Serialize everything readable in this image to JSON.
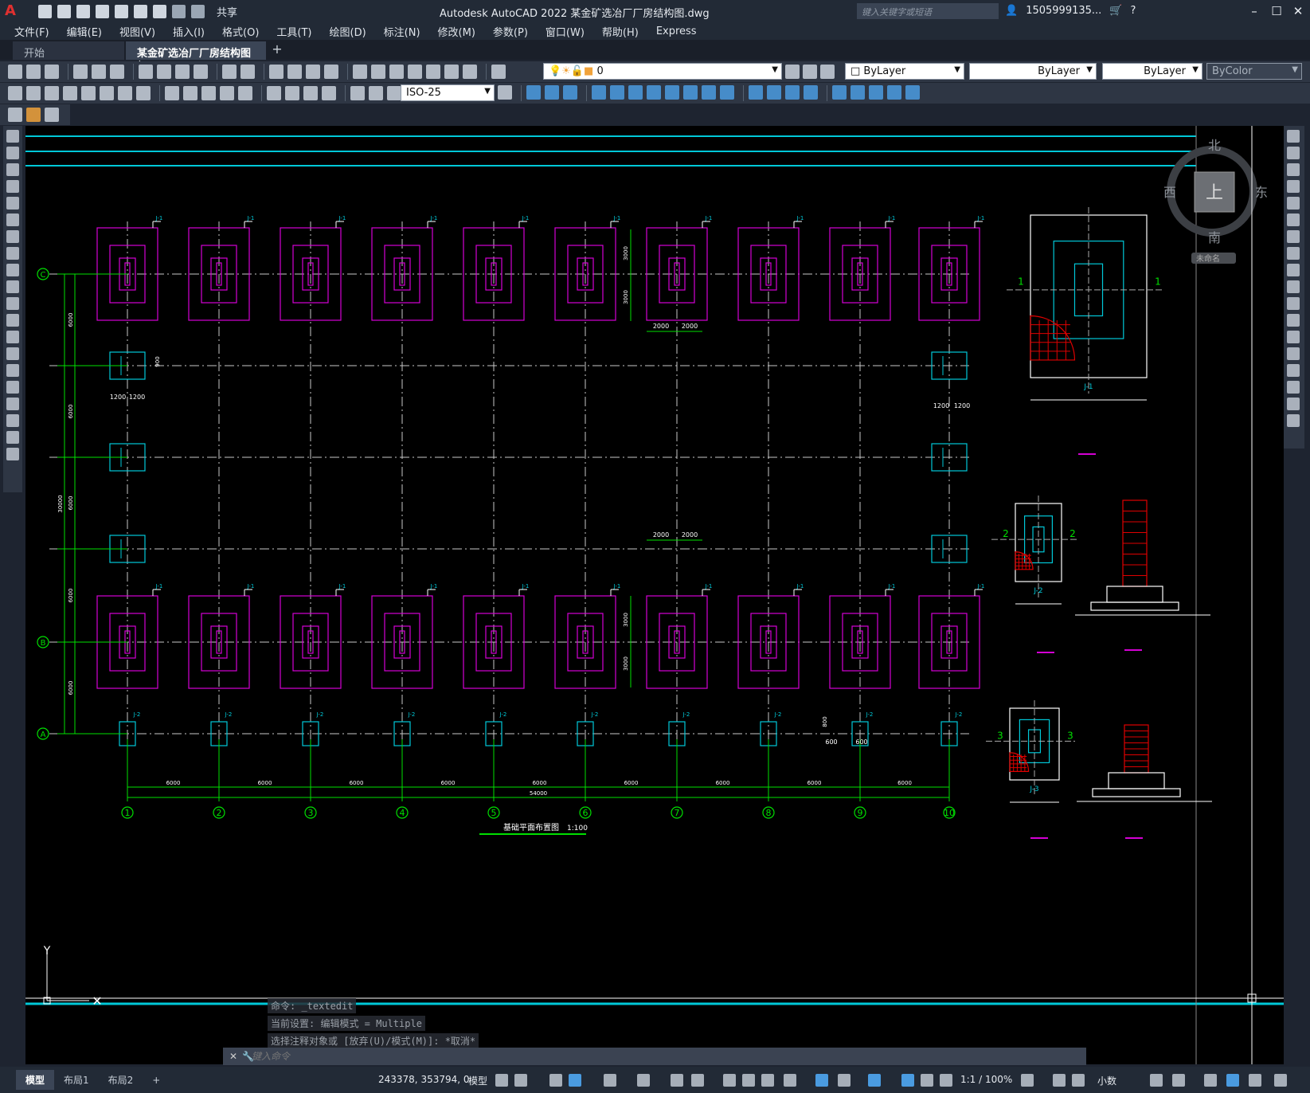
{
  "window": {
    "title": "Autodesk AutoCAD 2022    某金矿选冶厂厂房结构图.dwg",
    "share": "共享",
    "search_placeholder": "键入关键字或短语",
    "user": "1505999135..."
  },
  "menu": [
    "文件(F)",
    "编辑(E)",
    "视图(V)",
    "插入(I)",
    "格式(O)",
    "工具(T)",
    "绘图(D)",
    "标注(N)",
    "修改(M)",
    "参数(P)",
    "窗口(W)",
    "帮助(H)",
    "Express"
  ],
  "tabs": [
    {
      "label": "开始"
    },
    {
      "label": "某金矿选冶厂厂房结构图*"
    }
  ],
  "toolbar": {
    "layer": "0",
    "color": "ByLayer",
    "linetype": "ByLayer",
    "lineweight": "ByLayer",
    "plotstyle": "ByColor",
    "dimstyle": "ISO-25"
  },
  "viewcube": {
    "north": "北",
    "south": "南",
    "east": "东",
    "west": "西",
    "top": "上",
    "ucs": "未命名"
  },
  "drawing": {
    "plan_title": "基础平面布置图",
    "plan_scale": "1:100",
    "grid_cols": [
      "1",
      "2",
      "3",
      "4",
      "5",
      "6",
      "7",
      "8",
      "9",
      "10"
    ],
    "grid_rows": [
      "C",
      "B",
      "A"
    ],
    "bay_dim": "6000",
    "total_dim": "54000",
    "side_dims": [
      "6000",
      "6000",
      "6000",
      "6000",
      "6000"
    ],
    "side_total": "30000",
    "footing_dims": {
      "w2000": "2000",
      "h3000": "3000",
      "w1200": "1200",
      "h900": "900",
      "w600": "600",
      "h800": "800"
    },
    "footing_tags": {
      "j1": "J-1",
      "j2": "J-2",
      "j3": "J-3"
    },
    "detail_labels": {
      "d1": "1",
      "d2": "2",
      "d3": "3"
    }
  },
  "command": {
    "history": [
      "命令: _textedit",
      "当前设置: 编辑模式 = Multiple",
      "选择注释对象或 [放弃(U)/模式(M)]: *取消*"
    ],
    "placeholder": "键入命令"
  },
  "status": {
    "layouts": [
      "模型",
      "布局1",
      "布局2"
    ],
    "coords": "243378, 353794, 0",
    "model": "模型",
    "scale": "1:1 / 100%",
    "units": "小数"
  },
  "colors": {
    "magenta": "#d400d4",
    "cyan": "#00c8d8",
    "green": "#00e000",
    "red": "#e00000",
    "grid": "#c8c8c8"
  }
}
